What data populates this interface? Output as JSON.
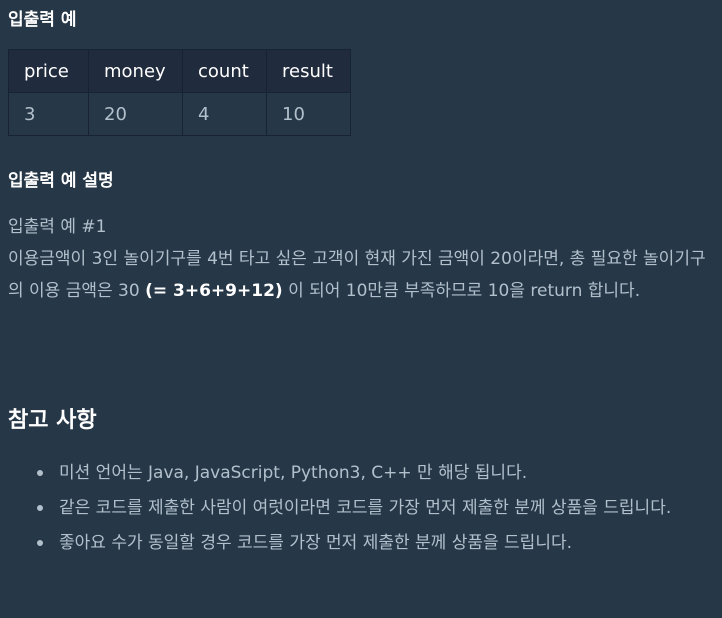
{
  "io_example": {
    "heading": "입출력 예",
    "columns": [
      "price",
      "money",
      "count",
      "result"
    ],
    "rows": [
      [
        "3",
        "20",
        "4",
        "10"
      ]
    ]
  },
  "io_explanation": {
    "heading": "입출력 예 설명",
    "example_label": "입출력 예 #1",
    "desc_part1": "이용금액이 3인 놀이기구를 4번 타고 싶은 고객이 현재 가진 금액이 20이라면, 총 필요한 놀이기구의 이용 금액은 30 ",
    "desc_bold": "(= 3+6+9+12)",
    "desc_part2": " 이 되어 10만큼 부족하므로 10을 return 합니다."
  },
  "notes": {
    "heading": "참고 사항",
    "items": [
      "미션 언어는 Java, JavaScript, Python3, C++ 만 해당 됩니다.",
      "같은 코드를 제출한 사람이 여럿이라면 코드를 가장 먼저 제출한 분께 상품을 드립니다.",
      "좋아요 수가 동일할 경우 코드를 가장 먼저 제출한 분께 상품을 드립니다."
    ]
  }
}
